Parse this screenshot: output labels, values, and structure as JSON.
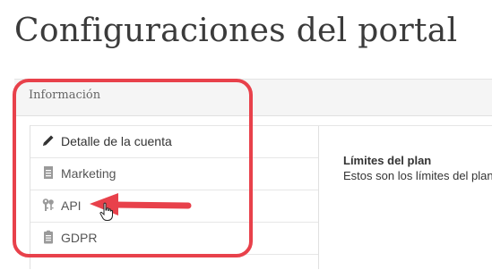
{
  "page": {
    "title": "Configuraciones del portal"
  },
  "panel": {
    "header": "Información"
  },
  "menu": {
    "items": [
      {
        "label": "Detalle de la cuenta",
        "icon": "pencil-icon"
      },
      {
        "label": "Marketing",
        "icon": "document-icon"
      },
      {
        "label": "API",
        "icon": "keys-icon"
      },
      {
        "label": "GDPR",
        "icon": "clipboard-icon"
      }
    ]
  },
  "content": {
    "plan_title": "Límites del plan",
    "plan_subtitle": "Estos son los límites del plan"
  },
  "colors": {
    "highlight": "#e8414b",
    "icon_dark": "#333333",
    "icon_muted": "#9a9a9a"
  }
}
